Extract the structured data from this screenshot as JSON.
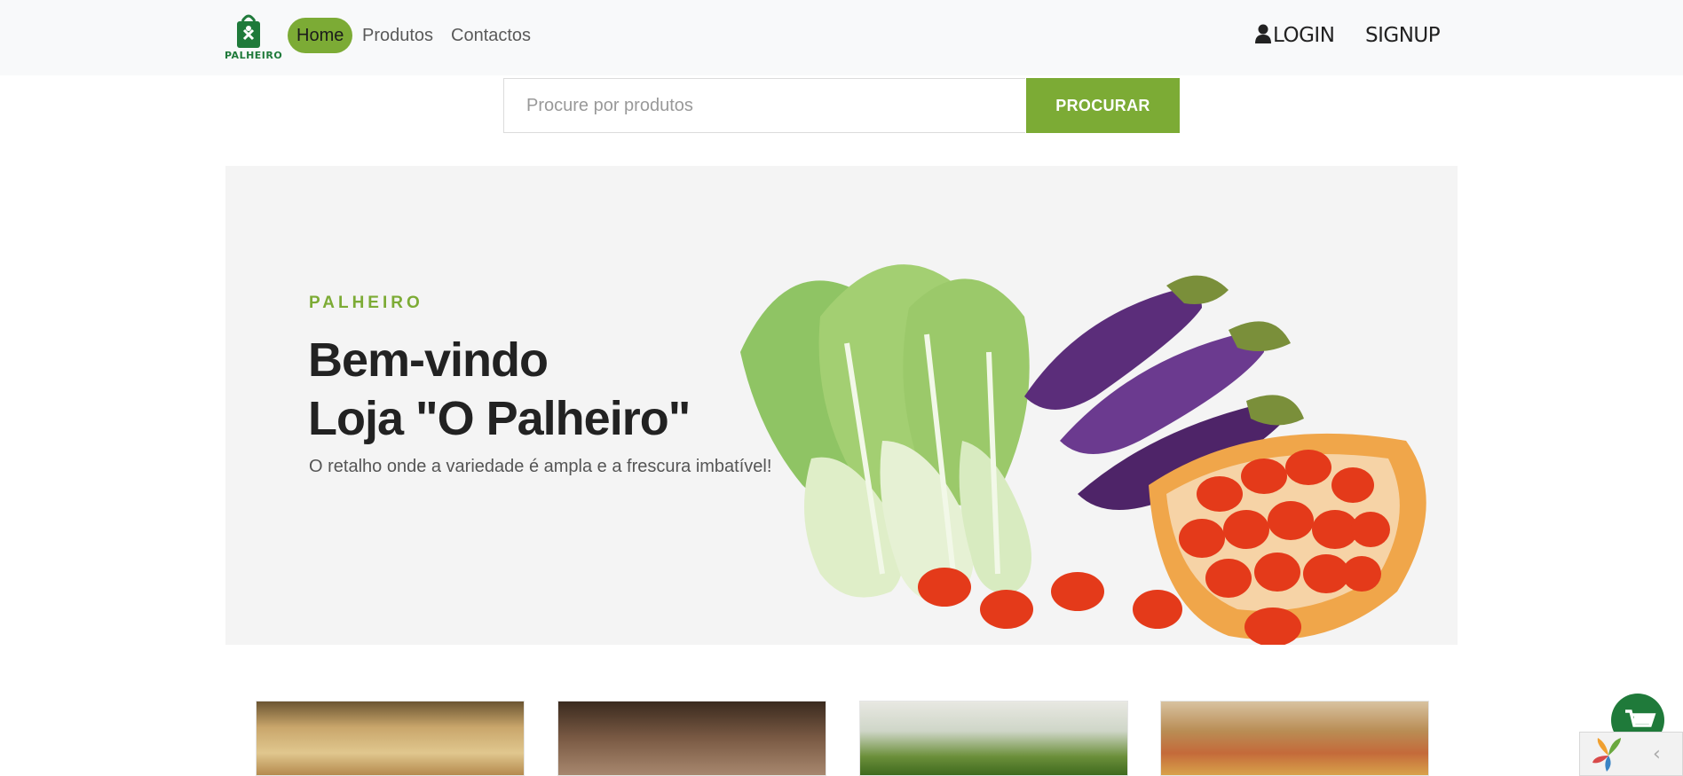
{
  "brand": {
    "logo_text": "PALHEIRO",
    "accent": "#7cab35",
    "logo_color": "#1f7a3a"
  },
  "nav": {
    "home": "Home",
    "produtos": "Produtos",
    "contactos": "Contactos",
    "login": "LOGIN",
    "signup": "SIGNUP"
  },
  "search": {
    "placeholder": "Procure por produtos",
    "button": "PROCURAR"
  },
  "hero": {
    "eyebrow": "PALHEIRO",
    "title_line1": "Bem-vindo",
    "title_line2": "Loja \"O Palheiro\"",
    "subtitle": "O retalho onde a variedade é ampla e a frescura imbatível!"
  },
  "products": [
    {
      "name": "product-nuts"
    },
    {
      "name": "product-glass-jar"
    },
    {
      "name": "product-herbs"
    },
    {
      "name": "product-grains"
    }
  ],
  "icons": {
    "user": "user-icon",
    "cart": "shopping-cart-icon",
    "logo": "shopping-bag-logo-icon",
    "widget": "yii-debug-logo-icon",
    "collapse": "chevron-left-icon"
  }
}
